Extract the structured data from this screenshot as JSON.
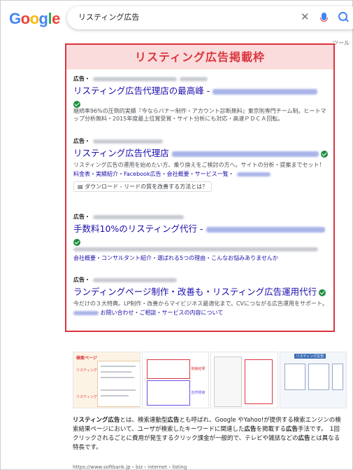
{
  "logo": {
    "letters": [
      "G",
      "o",
      "o",
      "g",
      "l",
      "e"
    ],
    "colors": [
      "#4285f4",
      "#ea4335",
      "#fbbc05",
      "#4285f4",
      "#34a853",
      "#ea4335"
    ]
  },
  "search": {
    "query": "リスティング広告"
  },
  "tabs": {
    "more_label": "ツール"
  },
  "ad_section": {
    "banner": "リスティング広告掲載枠",
    "accent_color": "#d9363e",
    "ads": [
      {
        "label": "広告・",
        "title": "リスティング広告代理店の最高峰 -",
        "desc": "継続率96%の圧倒的実績『今ならバナー制作・アカウント診断無料』東京則専門チーム制。ヒートマップ分析無料・2015年度最上位賞受賞・サイト分析にも対応・高速ＰＤＣＡ回転。"
      },
      {
        "label": "広告・",
        "title": "リスティング広告代理店",
        "desc": "リスティング広告の運用を始めたい方、乗り換えをご検討の方へ。サイトの分析・提案までセット！",
        "links": "料金表・実績紹介・Facebook広告・会社概要・サービス一覧・",
        "download": "ダウンロード - リードの質を改善する方法とは？"
      },
      {
        "label": "広告・",
        "title": "手数料10%のリスティング代行 -",
        "links": "会社概要・コンサルタント紹介・選ばれる5つの理由・こんなお悩みありませんか"
      },
      {
        "label": "広告・",
        "title": "ランディングページ制作・改善も・リスティング広告運用代行",
        "desc": "今だけの３大特典。LP制作・改善からマイビジネス最適化まで。CVにつながる広告運用をサポート。",
        "links": "お問い合わせ・ご相談・サービスの内容について"
      }
    ]
  },
  "images": {
    "img1_header": "検索ページ",
    "img1_label1": "リスティング広告",
    "img1_label2": "リスティング広告",
    "img2_label1": "検索結果",
    "img2_label2": "自然検索",
    "img4_header": "リスティング広告"
  },
  "snippet": {
    "parts": [
      {
        "t": "リスティング広告",
        "b": true
      },
      {
        "t": "とは、検索連動型",
        "b": false
      },
      {
        "t": "広告",
        "b": true
      },
      {
        "t": "とも呼ばれ、Google やYahoo!が提供する検索エンジンの検索結果ページにおいて、ユーザが検索したキーワードに関連した",
        "b": false
      },
      {
        "t": "広告",
        "b": true
      },
      {
        "t": "を掲載する",
        "b": false
      },
      {
        "t": "広告",
        "b": true
      },
      {
        "t": "手法です。　1回クリックされるごとに費用が発生するクリック課金が一般的で、テレビや雑誌などの",
        "b": false
      },
      {
        "t": "広告",
        "b": true
      },
      {
        "t": "とは異なる特長です。",
        "b": false
      }
    ],
    "url": "https://www.softbank.jp › biz › internet › listing"
  }
}
